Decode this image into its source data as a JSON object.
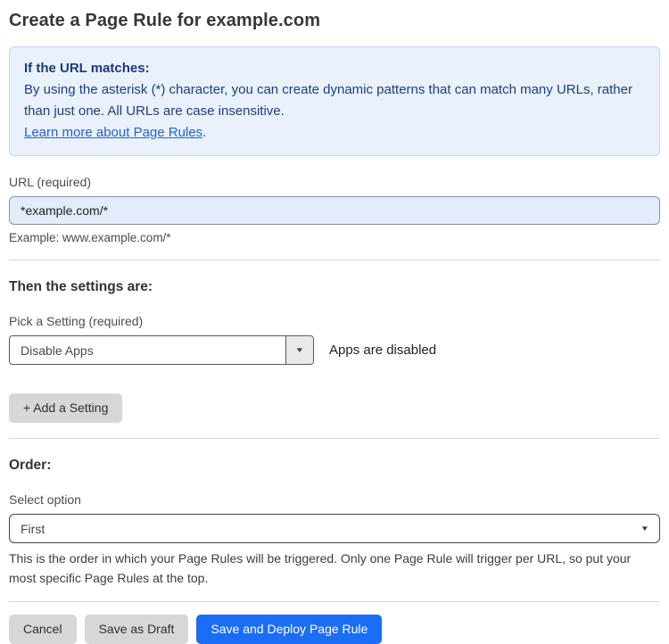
{
  "page": {
    "title": "Create a Page Rule for example.com"
  },
  "info_box": {
    "heading": "If the URL matches:",
    "body": "By using the asterisk (*) character, you can create dynamic patterns that can match many URLs, rather than just one. All URLs are case insensitive.",
    "link_label": "Learn more about Page Rules",
    "link_suffix": "."
  },
  "url_field": {
    "label": "URL (required)",
    "value": "*example.com/*",
    "helper": "Example: www.example.com/*"
  },
  "settings_section": {
    "heading": "Then the settings are:",
    "setting_label": "Pick a Setting (required)",
    "setting_value": "Disable Apps",
    "setting_status": "Apps are disabled",
    "add_setting_label": "+ Add a Setting"
  },
  "order_section": {
    "heading": "Order:",
    "select_label": "Select option",
    "select_value": "First",
    "helper": "This is the order in which your Page Rules will be triggered. Only one Page Rule will trigger per URL, so put your most specific Page Rules at the top."
  },
  "footer": {
    "cancel_label": "Cancel",
    "save_draft_label": "Save as Draft",
    "save_deploy_label": "Save and Deploy Page Rule"
  },
  "icons": {
    "dropdown_caret": "▼"
  },
  "colors": {
    "accent_blue": "#1a6ef5",
    "info_bg": "#e9f1fc",
    "info_border": "#bed5f2",
    "info_text": "#1e3e7f",
    "link_blue": "#2563cd",
    "input_bg": "#e2ecfb"
  }
}
